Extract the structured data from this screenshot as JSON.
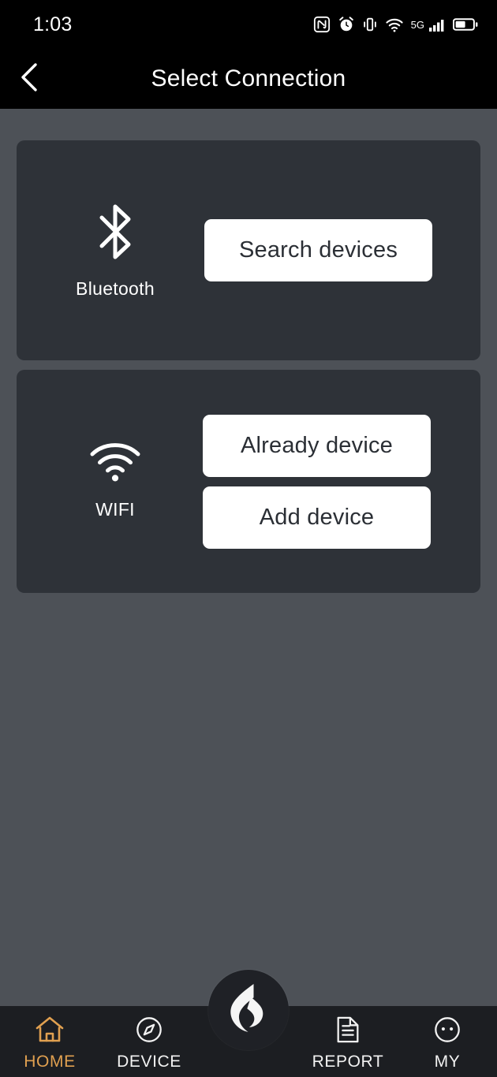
{
  "status_bar": {
    "time": "1:03",
    "icons": [
      "nfc-icon",
      "alarm-icon",
      "vibrate-icon",
      "wifi-icon",
      "signal-icon",
      "battery-icon"
    ],
    "network_label": "5G"
  },
  "app_bar": {
    "title": "Select Connection",
    "back_icon": "chevron-left-icon"
  },
  "theme": {
    "page_background": "#4d5157",
    "card_background": "#2e3238",
    "bar_background": "#000000",
    "nav_background": "#1c1e22",
    "button_background": "#ffffff",
    "button_text": "#2b2f35",
    "accent": "#e0a050",
    "text_primary": "#ffffff"
  },
  "connections": [
    {
      "id": "bluetooth",
      "icon": "bluetooth-icon",
      "label": "Bluetooth",
      "buttons": [
        {
          "id": "search-devices",
          "label": "Search devices"
        }
      ]
    },
    {
      "id": "wifi",
      "icon": "wifi-icon",
      "label": "WIFI",
      "buttons": [
        {
          "id": "already-device",
          "label": "Already device"
        },
        {
          "id": "add-device",
          "label": "Add device"
        }
      ]
    }
  ],
  "bottom_nav": {
    "active": "HOME",
    "items": [
      {
        "id": "home",
        "label": "HOME",
        "icon": "home-icon"
      },
      {
        "id": "device",
        "label": "DEVICE",
        "icon": "compass-icon"
      },
      {
        "id": "report",
        "label": "REPORT",
        "icon": "document-icon"
      },
      {
        "id": "my",
        "label": "MY",
        "icon": "face-icon"
      }
    ],
    "fab": {
      "id": "brand-fab",
      "icon": "brand-flame-logo"
    }
  }
}
